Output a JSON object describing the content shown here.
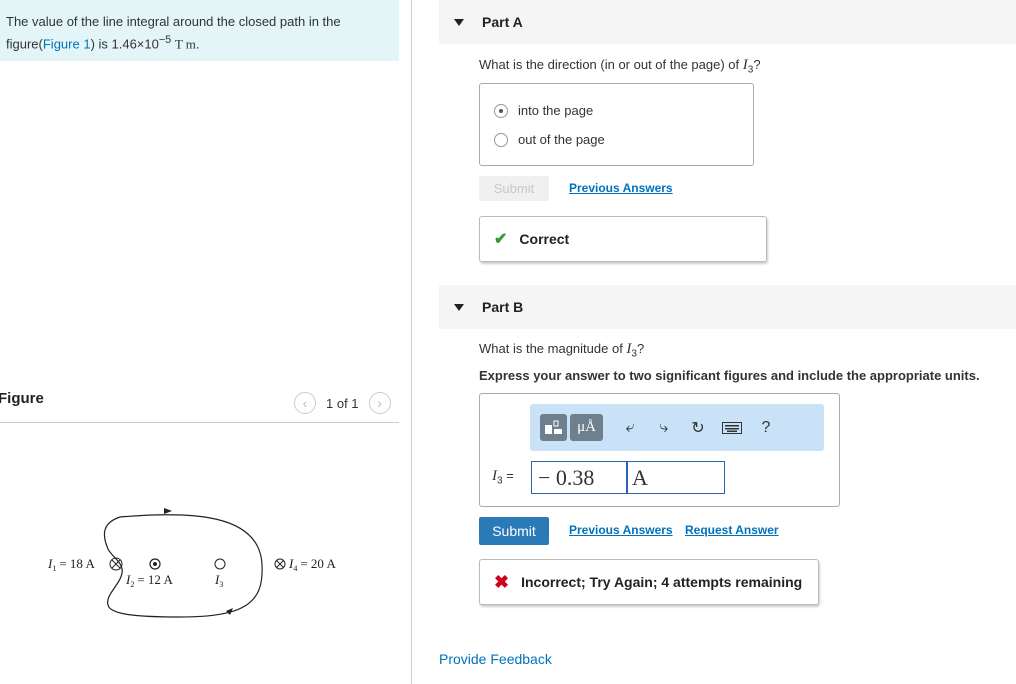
{
  "problem": {
    "text_before": "The value of the line integral around the closed path in the figure(",
    "figure_link": "Figure 1",
    "text_after": ") is 1.46×10",
    "exponent": "−5",
    "units": "T m",
    "period": "."
  },
  "figure_panel": {
    "title": "Figure",
    "count": "1 of 1",
    "prev_icon": "chevron-left-icon",
    "next_icon": "chevron-right-icon",
    "labels": {
      "i1": "I",
      "i1_sub": "1",
      "i1_value": "= 18 A",
      "i2": "I",
      "i2_sub": "2",
      "i2_value": "= 12 A",
      "i3": "I",
      "i3_sub": "3",
      "i4": "I",
      "i4_sub": "4",
      "i4_value": "= 20 A"
    }
  },
  "part_a": {
    "title": "Part A",
    "question_before": "What is the direction (in or out of the page) of ",
    "question_var": "I",
    "question_sub": "3",
    "question_after": "?",
    "choices": [
      {
        "label": "into the page",
        "selected": true
      },
      {
        "label": "out of the page",
        "selected": false
      }
    ],
    "submit_label": "Submit",
    "previous_answers_label": "Previous Answers",
    "result": "Correct"
  },
  "part_b": {
    "title": "Part B",
    "question_before": "What is the magnitude of ",
    "question_var": "I",
    "question_sub": "3",
    "question_after": "?",
    "instruction": "Express your answer to two significant figures and include the appropriate units.",
    "toolbar": {
      "units_button": "μÅ",
      "help": "?",
      "icons": [
        "templates-icon",
        "units-icon",
        "undo-icon",
        "redo-icon",
        "reset-icon",
        "keyboard-icon",
        "help-icon"
      ]
    },
    "answer_label_var": "I",
    "answer_label_sub": "3",
    "answer_label_eq": "=",
    "answer_value": "− 0.38",
    "answer_unit": "A",
    "submit_label": "Submit",
    "previous_answers_label": "Previous Answers",
    "request_answer_label": "Request Answer",
    "result": "Incorrect; Try Again; 4 attempts remaining"
  },
  "footer": {
    "provide_feedback": "Provide Feedback"
  },
  "colors": {
    "accent": "#0072bc",
    "problem_bg": "#e4f5f8",
    "submit_bg": "#2a7ab8",
    "correct": "#2e9b2e",
    "incorrect": "#d0021b",
    "toolbar_bg": "#c9e2f7"
  }
}
